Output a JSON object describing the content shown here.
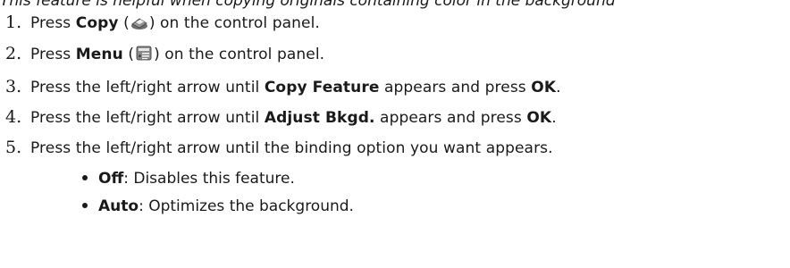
{
  "intro": {
    "text": "This feature is helpful when copying originals containing color in the background"
  },
  "steps": [
    {
      "number": "1.",
      "pre": "Press ",
      "bold": "Copy",
      "icon": "copy-icon",
      "post": " on the control panel."
    },
    {
      "number": "2.",
      "pre": "Press ",
      "bold": "Menu",
      "icon": "menu-icon",
      "post": " on the control panel."
    },
    {
      "number": "3.",
      "pre": "Press the left/right arrow until ",
      "bold": "Copy Feature",
      "mid": " appears and press ",
      "bold2": "OK",
      "post": "."
    },
    {
      "number": "4.",
      "pre": "Press the left/right arrow until ",
      "bold": "Adjust Bkgd.",
      "mid": " appears and press ",
      "bold2": "OK",
      "post": "."
    },
    {
      "number": "5.",
      "pre": "Press the left/right arrow until the binding option you want appears."
    }
  ],
  "bullets": [
    {
      "bold": "Off",
      "text": ": Disables this feature."
    },
    {
      "bold": "Auto",
      "text": ": Optimizes the background."
    }
  ]
}
